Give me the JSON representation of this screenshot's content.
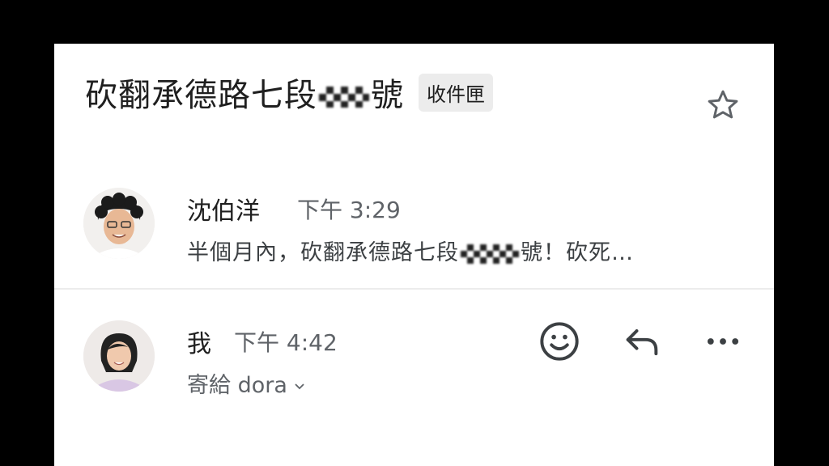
{
  "header": {
    "subject_prefix": "砍翻承德路七段",
    "subject_suffix": "號",
    "label": "收件匣",
    "star_icon": "star-outline-icon"
  },
  "messages": [
    {
      "sender": "沈伯洋",
      "time": "下午 3:29",
      "snippet_prefix": "半個月內，砍翻承德路七段",
      "snippet_suffix": "號！砍死…"
    },
    {
      "sender": "我",
      "time": "下午 4:42",
      "recipient": "寄給 dora",
      "actions": [
        "emoji-reaction-icon",
        "reply-icon",
        "more-options-icon"
      ]
    }
  ],
  "colors": {
    "background": "#000000",
    "card": "#ffffff",
    "text": "#1f1f1f",
    "secondary": "#5f6368"
  }
}
